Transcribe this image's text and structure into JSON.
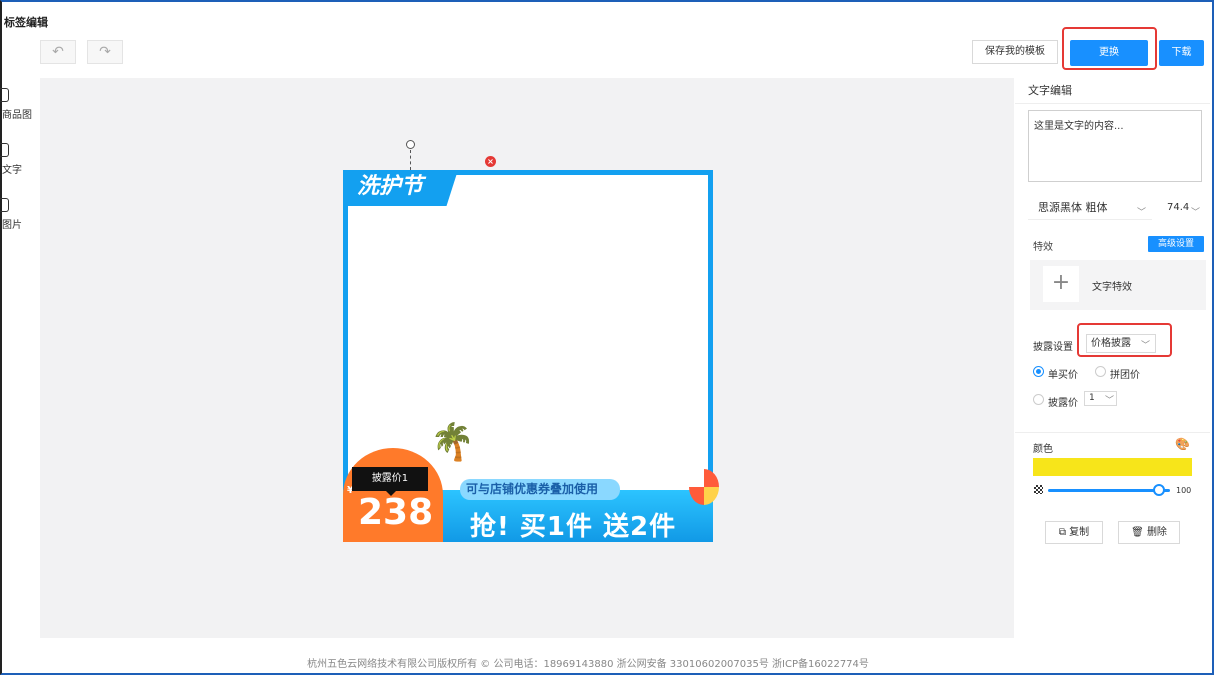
{
  "app_title": "标签编辑",
  "toolbar": {
    "undo_icon": "undo-arrow-icon",
    "redo_icon": "redo-arrow-icon",
    "save_template_label": "保存我的模板",
    "replace_label": "更换",
    "download_label": "下载"
  },
  "left_tools": [
    {
      "label": "商品图",
      "icon": "tag-icon"
    },
    {
      "label": "文字",
      "icon": "text-icon"
    },
    {
      "label": "图片",
      "icon": "image-icon"
    }
  ],
  "poster": {
    "tag_text": "洗护节",
    "coupon_text": "可与店铺优惠券叠加使用",
    "promo_text": "抢! 买1件 送2件",
    "price_tip": "披露价1",
    "currency": "¥",
    "price": "238"
  },
  "panel": {
    "header": "文字编辑",
    "text_content": "这里是文字的内容...",
    "font_family": "思源黑体 粗体",
    "font_size": "74.4",
    "effects_label": "特效",
    "advanced_label": "高级设置",
    "text_effect_label": "文字特效",
    "disclosure_label": "披露设置",
    "disclosure_value": "价格披露",
    "radio_single": "单买价",
    "radio_group": "拼团价",
    "radio_disclosed": "披露价",
    "disclosed_index": "1",
    "color_label": "颜色",
    "color_value": "#f7e51a",
    "opacity": "100",
    "copy_label": "复制",
    "delete_label": "删除"
  },
  "footer": "杭州五色云网络技术有限公司版权所有 © 公司电话：18969143880  浙公网安备 33010602007035号  浙ICP备16022774号"
}
